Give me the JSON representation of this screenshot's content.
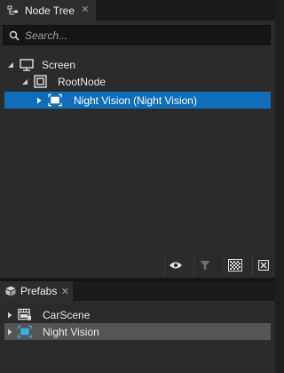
{
  "node_tree_tab": {
    "icon": "node-tree-icon",
    "label": "Node Tree",
    "close": "✕"
  },
  "search": {
    "icon": "search-icon",
    "placeholder": "Search..."
  },
  "tree": [
    {
      "label": "Screen",
      "icon": "monitor-icon",
      "expanded": true,
      "selected": false
    },
    {
      "label": "RootNode",
      "icon": "root-node-icon",
      "expanded": true,
      "selected": false
    },
    {
      "label": "Night Vision (Night Vision)",
      "icon": "prefab-node-icon",
      "expanded": false,
      "selected": true
    }
  ],
  "toolbar": {
    "buttons": [
      "visibility-eye-icon",
      "filter-icon",
      "checkerboard-icon",
      "collapse-icon"
    ]
  },
  "prefabs_tab": {
    "icon": "cube-icon",
    "label": "Prefabs",
    "close": "✕"
  },
  "prefabs": [
    {
      "label": "CarScene",
      "icon": "scene-icon",
      "selected": false
    },
    {
      "label": "Night Vision",
      "icon": "prefab-icon",
      "selected": true
    }
  ],
  "colors": {
    "selection_blue": "#0f6dba",
    "selection_gray": "#555555",
    "panel_bg": "#2b2b2b",
    "prefab_icon_cyan": "#3ab0e8"
  }
}
